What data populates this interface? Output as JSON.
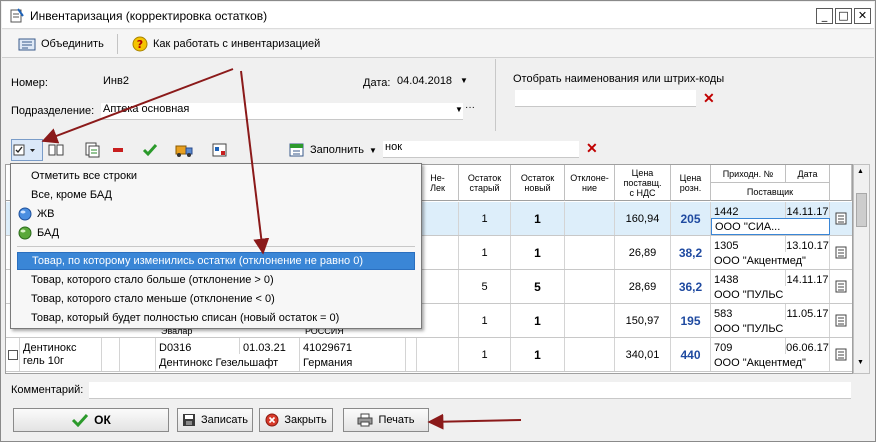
{
  "window": {
    "title": "Инвентаризация (корректировка остатков)"
  },
  "toolbar": {
    "merge_label": "Объединить",
    "help_label": "Как работать с инвентаризацией"
  },
  "form": {
    "number_label": "Номер:",
    "number_value": "Инв2",
    "date_label": "Дата:",
    "date_value": "04.04.2018",
    "department_label": "Подразделение:",
    "department_value": "Аптека основная",
    "filter_label": "Отобрать наименования или штрих-коды",
    "filter_value": ""
  },
  "grid_toolbar": {
    "fill_label": "Заполнить",
    "search_value": "нок"
  },
  "menu": {
    "items": [
      "Отметить все строки",
      "Все, кроме БАД",
      "ЖВ",
      "БАД",
      "Товар, по которому изменились остатки (отклонение не равно 0)",
      "Товар, которого стало больше (отклонение > 0)",
      "Товар, которого стало меньше (отклонение < 0)",
      "Товар, который будет полностью списан (новый остаток = 0)"
    ]
  },
  "grid": {
    "headers": {
      "nelek": "Не-\nЛек",
      "old": "Остаток\nстарый",
      "new": "Остаток\nновый",
      "dev": "Отклоне-\nние",
      "cost": "Цена\nпоставщ.\nс НДС",
      "retail": "Цена\nрозн.",
      "receipt": "Приходн. №",
      "date": "Дата",
      "supplier": "Поставщик"
    },
    "rows": [
      {
        "old": "1",
        "new": "1",
        "cost": "160,94",
        "retail": "205",
        "receipt": "1442",
        "date": "14.11.17",
        "supplier": "ООО ''СИА..."
      },
      {
        "old": "1",
        "new": "1",
        "cost": "26,89",
        "retail": "38,2",
        "receipt": "1305",
        "date": "13.10.17",
        "supplier": "ООО \"Акцентмед\""
      },
      {
        "old": "5",
        "new": "5",
        "cost": "28,69",
        "retail": "36,2",
        "receipt": "1438",
        "date": "14.11.17",
        "supplier": "ООО \"ПУЛЬС"
      },
      {
        "old": "1",
        "new": "1",
        "cost": "150,97",
        "retail": "195",
        "receipt": "583",
        "date": "11.05.17",
        "supplier": "ООО \"ПУЛЬС",
        "name_fragment": "Эвалар",
        "country_fragment": "РОССИЯ"
      },
      {
        "name": "Дентинокс гель 10г",
        "code": "D0316",
        "expiry": "01.03.21",
        "barcode": "41029671",
        "maker": "Дентинокс Гезельшафт",
        "country": "Германия",
        "old": "1",
        "new": "1",
        "cost": "340,01",
        "retail": "440",
        "receipt": "709",
        "date": "06.06.17",
        "supplier": "ООО \"Акцентмед\""
      }
    ]
  },
  "comment": {
    "label": "Комментарий:",
    "value": ""
  },
  "buttons": {
    "ok": "ОК",
    "save": "Записать",
    "close": "Закрыть",
    "print": "Печать"
  },
  "colors": {
    "arrow": "#8b1a1a",
    "highlight": "#3a86d6",
    "price": "#1f4aa0"
  }
}
